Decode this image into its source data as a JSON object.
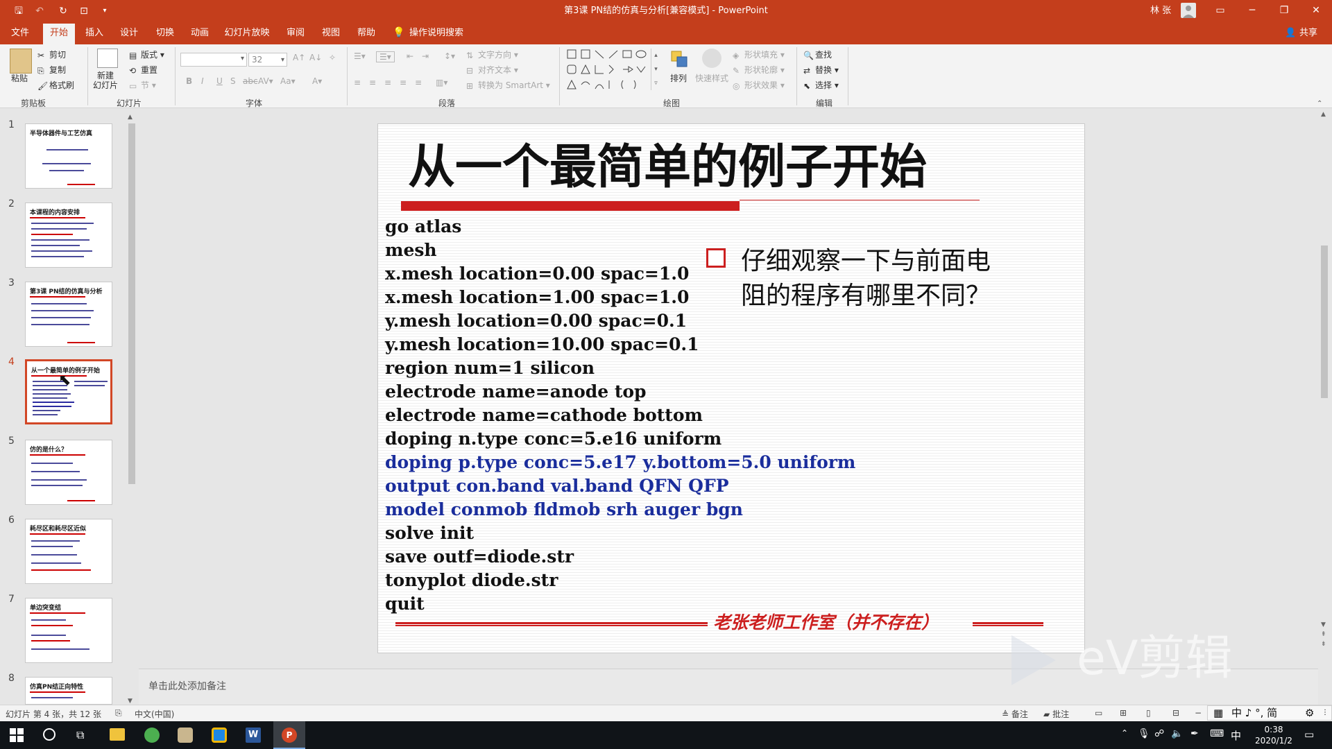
{
  "app": {
    "window_title": "第3课 PN结的仿真与分析[兼容模式] - PowerPoint",
    "user": "林 张"
  },
  "tabs": [
    "文件",
    "开始",
    "插入",
    "设计",
    "切换",
    "动画",
    "幻灯片放映",
    "审阅",
    "视图",
    "帮助"
  ],
  "active_tab": "开始",
  "tell_me": "操作说明搜索",
  "share": "共享",
  "ribbon": {
    "clipboard": {
      "paste": "粘贴",
      "cut": "剪切",
      "copy": "复制",
      "format_painter": "格式刷",
      "label": "剪贴板"
    },
    "slides": {
      "new_slide": "新建\n幻灯片",
      "layout": "版式",
      "reset": "重置",
      "section": "节",
      "label": "幻灯片"
    },
    "font": {
      "name": "",
      "size": "32",
      "label": "字体",
      "case": "Aa"
    },
    "paragraph": {
      "text_direction": "文字方向",
      "align_text": "对齐文本",
      "smartart": "转换为 SmartArt",
      "label": "段落"
    },
    "drawing": {
      "arrange": "排列",
      "quick_styles": "快速样式",
      "shape_fill": "形状填充",
      "shape_outline": "形状轮廓",
      "shape_effects": "形状效果",
      "label": "绘图"
    },
    "editing": {
      "find": "查找",
      "replace": "替换",
      "select": "选择",
      "label": "编辑"
    }
  },
  "thumbnails": [
    {
      "num": "1",
      "title": "半导体器件与工艺仿真"
    },
    {
      "num": "2",
      "title": "本课程的内容安排"
    },
    {
      "num": "3",
      "title": "第3课 PN结的仿真与分析"
    },
    {
      "num": "4",
      "title": "从一个最简单的例子开始"
    },
    {
      "num": "5",
      "title": "仿的是什么？"
    },
    {
      "num": "6",
      "title": "耗尽区和耗尽区近似"
    },
    {
      "num": "7",
      "title": "单边突变结"
    },
    {
      "num": "8",
      "title": "仿真PN结正向特性"
    }
  ],
  "selected_thumbnail": "4",
  "slide": {
    "title": "从一个最简单的例子开始",
    "code_lines": [
      {
        "text": "go atlas",
        "color": "black"
      },
      {
        "text": "mesh",
        "color": "black"
      },
      {
        "text": "x.mesh location=0.00 spac=1.0",
        "color": "black"
      },
      {
        "text": "x.mesh location=1.00 spac=1.0",
        "color": "black"
      },
      {
        "text": "y.mesh location=0.00 spac=0.1",
        "color": "black"
      },
      {
        "text": "y.mesh location=10.00 spac=0.1",
        "color": "black"
      },
      {
        "text": "region num=1 silicon",
        "color": "black"
      },
      {
        "text": "electrode name=anode top",
        "color": "black"
      },
      {
        "text": "electrode name=cathode bottom",
        "color": "black"
      },
      {
        "text": "doping n.type conc=5.e16 uniform",
        "color": "black"
      },
      {
        "text": "doping p.type conc=5.e17 y.bottom=5.0 uniform",
        "color": "blue"
      },
      {
        "text": "output con.band val.band QFN QFP",
        "color": "blue"
      },
      {
        "text": "model conmob fldmob srh auger bgn",
        "color": "blue"
      },
      {
        "text": "solve init",
        "color": "black"
      },
      {
        "text": "save outf=diode.str",
        "color": "black"
      },
      {
        "text": "tonyplot diode.str",
        "color": "black"
      },
      {
        "text": "quit",
        "color": "black"
      }
    ],
    "note_line1": "仔细观察一下与前面电",
    "note_line2": "阻的程序有哪里不同？",
    "footer": "老张老师工作室（并不存在）"
  },
  "notes_placeholder": "单击此处添加备注",
  "status": {
    "slide_info": "幻灯片 第 4 张，共 12 张",
    "language": "中文(中国)",
    "notes": "备注",
    "comments": "批注"
  },
  "watermark": "eV剪辑",
  "taskbar": {
    "time": "0:38",
    "date": "2020/1/2",
    "ime": "中"
  },
  "ime_toolbar": "中 ♪ °, 简",
  "colors": {
    "accent": "#c43e1c",
    "code_blue": "#1a2d9c",
    "slide_red": "#cc1f1f"
  }
}
